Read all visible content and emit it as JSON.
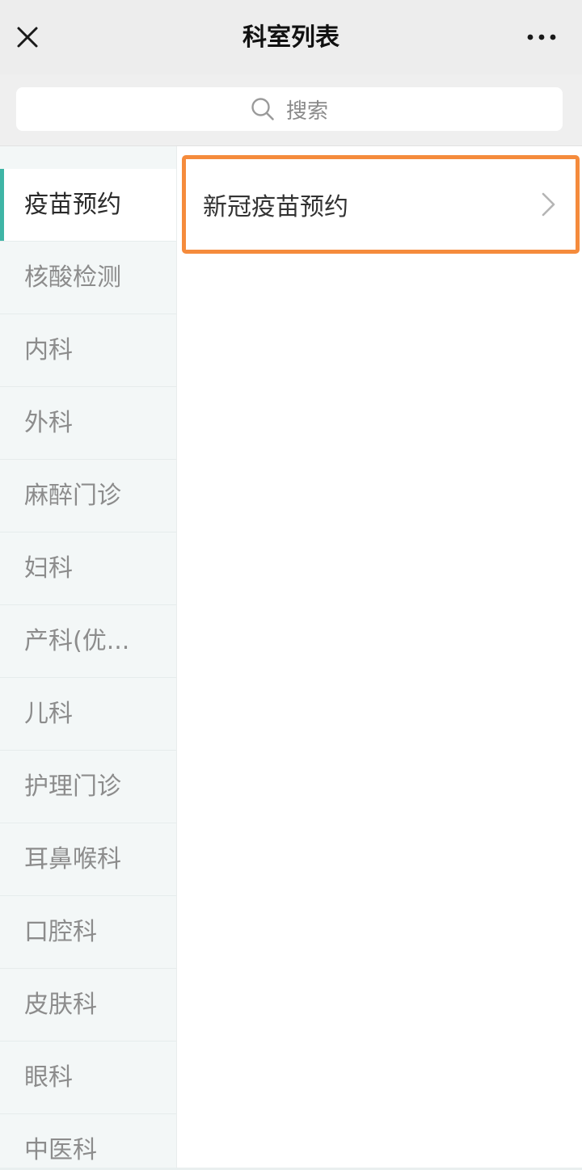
{
  "navbar": {
    "title": "科室列表",
    "close_icon": "close-icon",
    "more_icon": "more-horizontal-icon"
  },
  "search": {
    "placeholder": "搜索",
    "icon": "search-icon"
  },
  "sidebar": {
    "active_index": 0,
    "accent_color": "#3fb5a6",
    "items": [
      {
        "label": "疫苗预约"
      },
      {
        "label": "核酸检测"
      },
      {
        "label": "内科"
      },
      {
        "label": "外科"
      },
      {
        "label": "麻醉门诊"
      },
      {
        "label": "妇科"
      },
      {
        "label": "产科(优..."
      },
      {
        "label": "儿科"
      },
      {
        "label": "护理门诊"
      },
      {
        "label": "耳鼻喉科"
      },
      {
        "label": "口腔科"
      },
      {
        "label": "皮肤科"
      },
      {
        "label": "眼科"
      },
      {
        "label": "中医科"
      }
    ]
  },
  "content": {
    "items": [
      {
        "label": "新冠疫苗预约",
        "icon": "chevron-right-icon",
        "highlight_color": "#f58b3c"
      }
    ]
  }
}
